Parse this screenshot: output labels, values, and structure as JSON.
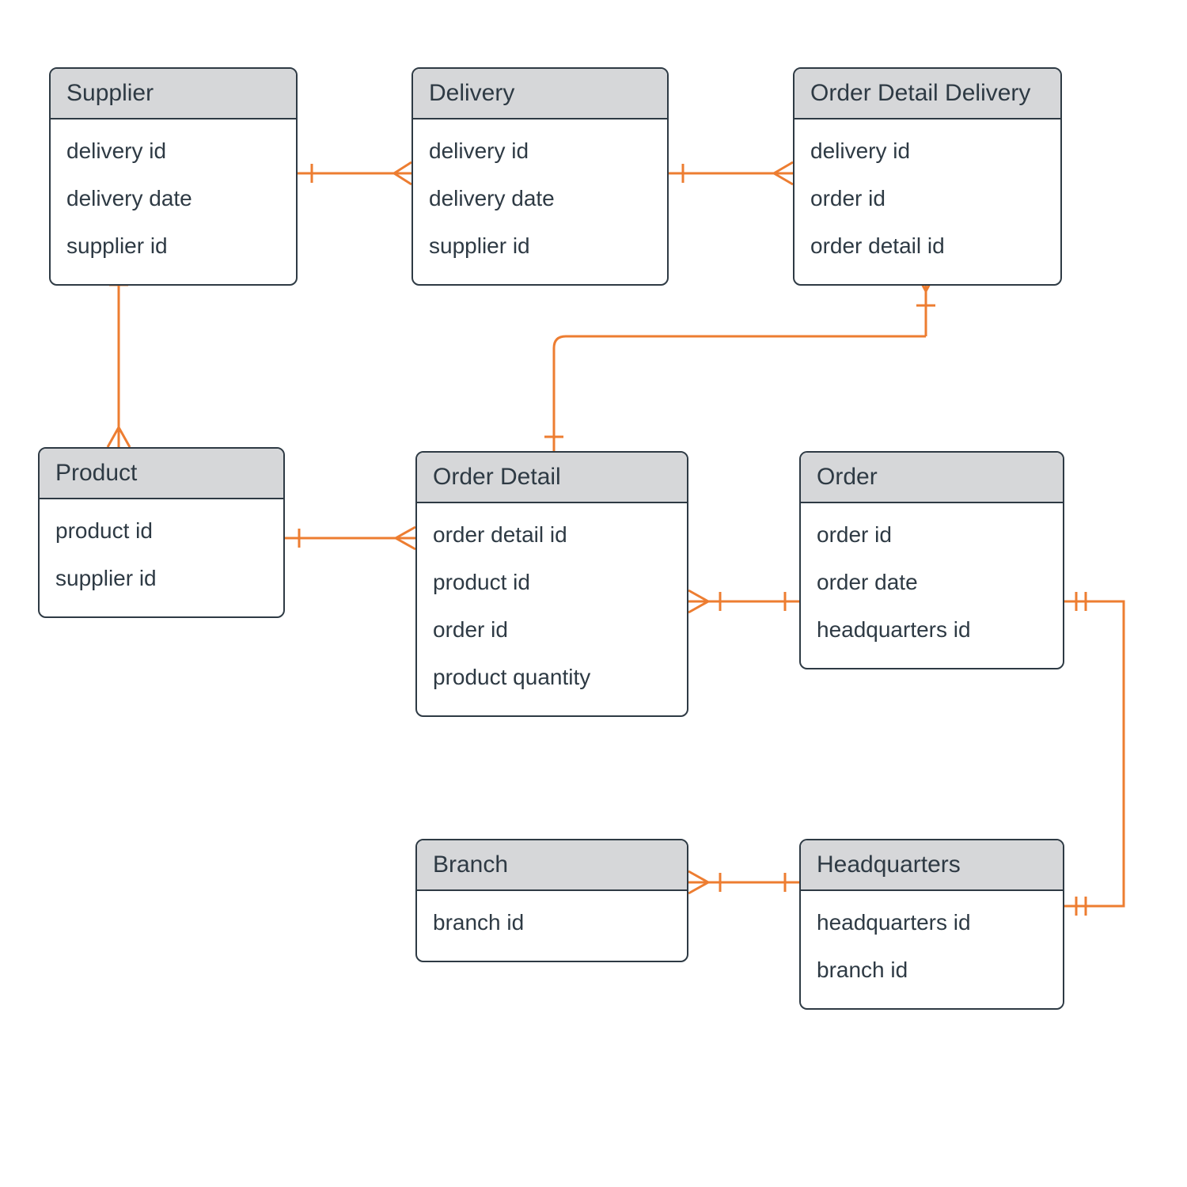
{
  "diagram_type": "entity-relationship",
  "colors": {
    "connector": "#ed7d31",
    "entity_border": "#2e3a44",
    "entity_header_bg": "#d6d7d9",
    "entity_body_bg": "#ffffff",
    "text": "#2e3a44"
  },
  "entities": {
    "supplier": {
      "name": "Supplier",
      "attributes": [
        "delivery id",
        "delivery date",
        "supplier id"
      ]
    },
    "delivery": {
      "name": "Delivery",
      "attributes": [
        "delivery id",
        "delivery date",
        "supplier id"
      ]
    },
    "order_detail_delivery": {
      "name": "Order Detail Delivery",
      "attributes": [
        "delivery id",
        "order id",
        "order detail id"
      ]
    },
    "product": {
      "name": "Product",
      "attributes": [
        "product id",
        "supplier id"
      ]
    },
    "order_detail": {
      "name": "Order Detail",
      "attributes": [
        "order detail id",
        "product id",
        "order id",
        "product quantity"
      ]
    },
    "order": {
      "name": "Order",
      "attributes": [
        "order id",
        "order date",
        "headquarters id"
      ]
    },
    "branch": {
      "name": "Branch",
      "attributes": [
        "branch id"
      ]
    },
    "headquarters": {
      "name": "Headquarters",
      "attributes": [
        "headquarters id",
        "branch id"
      ]
    }
  },
  "relationships": [
    {
      "from": "supplier",
      "to": "delivery",
      "cardinality": "one-to-many"
    },
    {
      "from": "delivery",
      "to": "order_detail_delivery",
      "cardinality": "one-to-many"
    },
    {
      "from": "supplier",
      "to": "product",
      "cardinality": "one-to-many"
    },
    {
      "from": "product",
      "to": "order_detail",
      "cardinality": "one-to-many"
    },
    {
      "from": "order",
      "to": "order_detail",
      "cardinality": "one-to-many"
    },
    {
      "from": "order_detail",
      "to": "order_detail_delivery",
      "cardinality": "one-to-many"
    },
    {
      "from": "headquarters",
      "to": "order",
      "cardinality": "one-to-one"
    },
    {
      "from": "headquarters",
      "to": "branch",
      "cardinality": "one-to-many"
    }
  ]
}
